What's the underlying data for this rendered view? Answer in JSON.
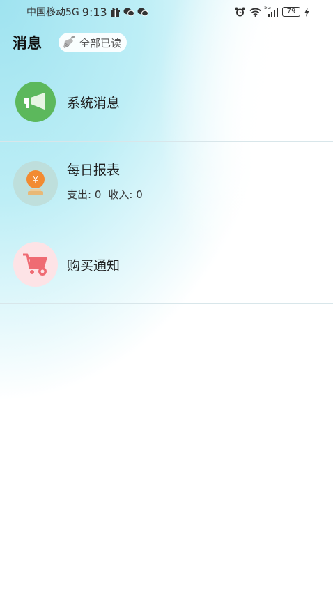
{
  "status_bar": {
    "carrier": "中国移动5G",
    "time": "9:13",
    "battery": "79",
    "network": "5G"
  },
  "header": {
    "title": "消息",
    "mark_all_read": "全部已读"
  },
  "messages": [
    {
      "title": "系统消息",
      "icon": "megaphone-icon",
      "color": "#5cb85c"
    },
    {
      "title": "每日报表",
      "icon": "yuan-coin-icon",
      "color": "#f28b32",
      "expense_label": "支出:",
      "expense_value": "0",
      "income_label": "收入:",
      "income_value": "0"
    },
    {
      "title": "购买通知",
      "icon": "shopping-cart-icon",
      "color": "#ef6b73"
    }
  ]
}
